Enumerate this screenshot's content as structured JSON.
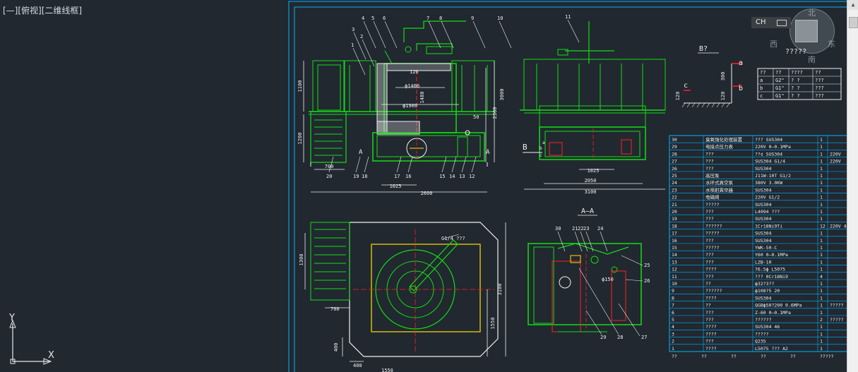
{
  "viewport": {
    "label": "[—][俯视][二维线框]"
  },
  "viewcube": {
    "north": "北",
    "south": "南",
    "east": "东",
    "west": "西",
    "wcs": "?????"
  },
  "language_bar": {
    "text": "CH"
  },
  "ucs": {
    "y": "Y",
    "x": "X"
  },
  "drawing": {
    "front": {
      "dims": [
        "1100",
        "1200",
        "700",
        "1025",
        "2600",
        "3000",
        "2300",
        "50",
        "1480",
        "ϕ1400",
        "ϕ1900",
        "120"
      ],
      "callouts": [
        "1",
        "2",
        "3",
        "4",
        "5",
        "6",
        "7",
        "8",
        "9",
        "10",
        "12",
        "13",
        "14",
        "15",
        "16",
        "17",
        "18",
        "19",
        "20"
      ],
      "section_marks": [
        "A",
        "A"
      ]
    },
    "side": {
      "dims": [
        "2050",
        "3100",
        "1025"
      ],
      "callouts": [
        "11"
      ],
      "arrow_label": "B",
      "small_labels": [
        "a",
        "b",
        "c"
      ]
    },
    "plan": {
      "dims": [
        "1300",
        "700",
        "1550",
        "3100",
        "400",
        "400",
        "1550"
      ],
      "note": "G1/4 ???"
    },
    "section": {
      "title": "A—A",
      "dims": [
        "ϕ150"
      ],
      "callouts": [
        "30",
        "21",
        "22",
        "23",
        "24",
        "25",
        "26",
        "27",
        "28",
        "29"
      ]
    },
    "detail": {
      "title": "B?",
      "dims": [
        "300",
        "120",
        "120"
      ],
      "labels": [
        "a",
        "b",
        "c"
      ]
    },
    "nozzle_table": {
      "header": [
        "??",
        "??",
        "????",
        "??"
      ],
      "rows": [
        [
          "a",
          "G2\"",
          "?  ?",
          "???"
        ],
        [
          "b",
          "G1\"",
          "?  ?",
          "???"
        ],
        [
          "c",
          "G1\"",
          "?  ?",
          "???"
        ]
      ]
    },
    "bom": {
      "rows": [
        [
          "30",
          "臭氧强化处理装置",
          "???   SUS304",
          "1",
          ""
        ],
        [
          "29",
          "电接点压力表",
          "220V  0—0.1MPa",
          "1",
          ""
        ],
        [
          "28",
          "???",
          "??¢  SUS304",
          "1",
          "220V"
        ],
        [
          "27",
          "???",
          "SUS304   G1/4",
          "1",
          "220V"
        ],
        [
          "26",
          "???",
          "SUS304",
          "1",
          ""
        ],
        [
          "25",
          "高压泵",
          "J11W-10T   G1/2",
          "1",
          ""
        ],
        [
          "24",
          "水环式真空泵",
          "380V   3.0KW",
          "1",
          ""
        ],
        [
          "23",
          "水喷射真空器",
          "SUS304",
          "1",
          ""
        ],
        [
          "22",
          "电磁阀",
          "220V   G1/2",
          "1",
          ""
        ],
        [
          "21",
          "?????",
          "SUS304",
          "1",
          ""
        ],
        [
          "20",
          "???",
          "L4094     ???",
          "1",
          ""
        ],
        [
          "19",
          "???",
          "SUS304",
          "1",
          ""
        ],
        [
          "18",
          "??????",
          "1Cr18Ni9Ti",
          "12",
          "220V   4"
        ],
        [
          "17",
          "?????",
          "SUS304",
          "1",
          ""
        ],
        [
          "16",
          "???",
          "SUS304",
          "1",
          ""
        ],
        [
          "15",
          "?????",
          "YWK-50-C",
          "1",
          ""
        ],
        [
          "14",
          "???",
          "Y60  0—0.1MPa",
          "1",
          ""
        ],
        [
          "13",
          "???",
          "LZB-10",
          "1",
          ""
        ],
        [
          "12",
          "????",
          "76.5ϕ   L5075",
          "1",
          ""
        ],
        [
          "11",
          "???",
          "???   0Cr18Ni9",
          "4",
          ""
        ],
        [
          "10",
          "??",
          "ϕ32?3??",
          "1",
          ""
        ],
        [
          "9",
          "??????",
          "ϕ108?5   20",
          "1",
          ""
        ],
        [
          "8",
          "????",
          "SUS304",
          "1",
          ""
        ],
        [
          "7",
          "??",
          "QGBϕ50?200   0.6MPa",
          "1",
          "?????"
        ],
        [
          "6",
          "???",
          "Z-60   0—0.1MPa",
          "1",
          ""
        ],
        [
          "5",
          "???",
          "??????",
          "2",
          "?????"
        ],
        [
          "4",
          "????",
          "SUS304   46",
          "1",
          ""
        ],
        [
          "3",
          "????",
          "?????",
          "1",
          ""
        ],
        [
          "2",
          "???",
          "Q235",
          "1",
          ""
        ],
        [
          "1",
          "????",
          "L5075   ???  A2",
          "1",
          ""
        ]
      ],
      "footer": [
        "??",
        "??",
        "??",
        "??",
        "??",
        "?????"
      ]
    }
  },
  "colors": {
    "background": "#212830",
    "frame": "#00b4ff",
    "geometry": "#14dc14",
    "dimension": "#f0f0f0",
    "centerline": "#ff2020",
    "hatch": "#e8e8e8",
    "highlight": "#ffe000",
    "callout": "#ffff66"
  }
}
